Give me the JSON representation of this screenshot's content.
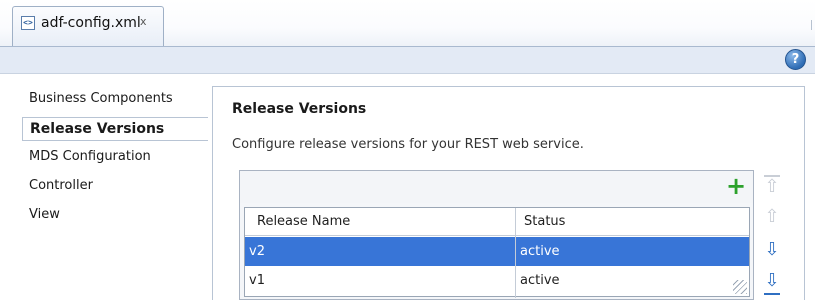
{
  "tab": {
    "title": "adf-config.xml",
    "close_glyph": "x",
    "icon": "xml-file-icon",
    "icon_glyph": "<>"
  },
  "header": {
    "help_glyph": "?",
    "help_icon": "help-icon"
  },
  "nav": {
    "items": [
      {
        "label": "Business Components",
        "selected": false
      },
      {
        "label": "Release Versions",
        "selected": true
      },
      {
        "label": "MDS Configuration",
        "selected": false
      },
      {
        "label": "Controller",
        "selected": false
      },
      {
        "label": "View",
        "selected": false
      }
    ]
  },
  "panel": {
    "title": "Release Versions",
    "description": "Configure release versions for your REST web service.",
    "toolbar": {
      "add_icon": "add-icon",
      "add_glyph": "+"
    },
    "table": {
      "columns": [
        "Release Name",
        "Status"
      ],
      "rows": [
        {
          "name": "v2",
          "status": "active",
          "selected": true
        },
        {
          "name": "v1",
          "status": "active",
          "selected": false
        }
      ]
    },
    "side_buttons": [
      {
        "icon": "move-to-top-icon",
        "glyph": "⇧",
        "enabled": false
      },
      {
        "icon": "move-up-icon",
        "glyph": "⇧",
        "enabled": false
      },
      {
        "icon": "move-down-icon",
        "glyph": "⇩",
        "enabled": true
      },
      {
        "icon": "move-to-bottom-icon",
        "glyph": "⇩",
        "enabled": true
      }
    ]
  },
  "colors": {
    "selection": "#3875d7",
    "header_bar": "#e3eaf5",
    "add_green": "#2ca12c",
    "arrow_blue": "#2f6fc2"
  }
}
